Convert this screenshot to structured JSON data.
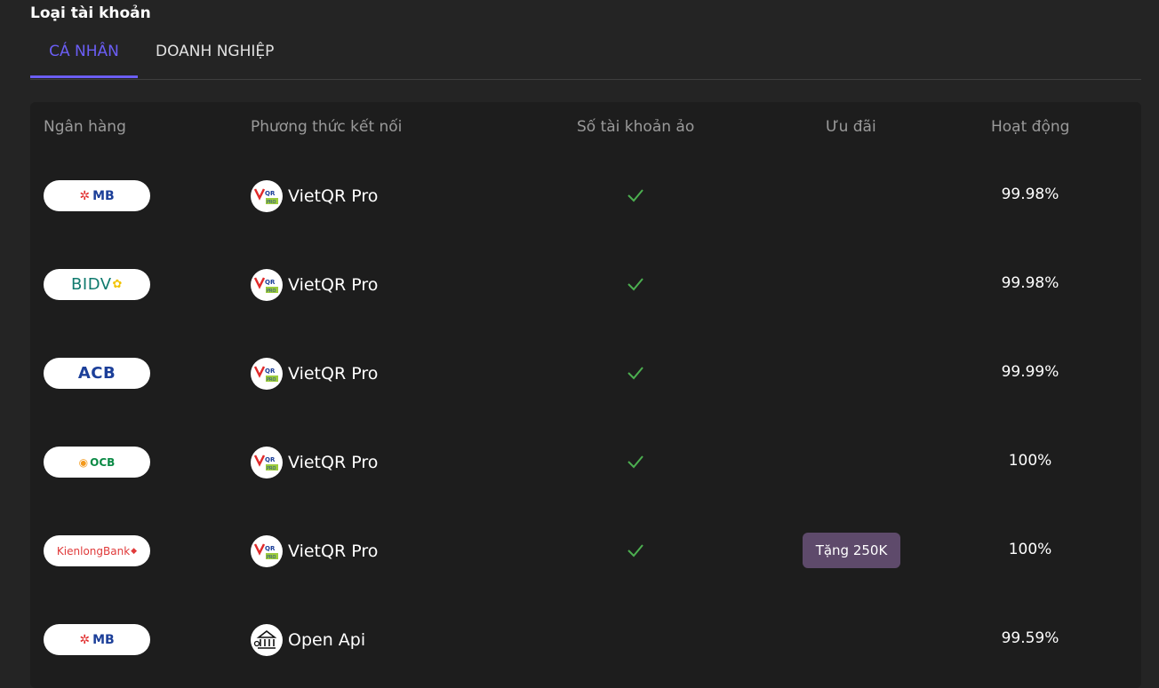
{
  "section_title": "Loại tài khoản",
  "tabs": [
    {
      "label": "CÁ NHÂN",
      "active": true
    },
    {
      "label": "DOANH NGHIỆP",
      "active": false
    }
  ],
  "table": {
    "headers": {
      "bank": "Ngân hàng",
      "method": "Phương thức kết nối",
      "virtual_account": "Số tài khoản ảo",
      "promo": "Ưu đãi",
      "uptime": "Hoạt động"
    },
    "rows": [
      {
        "bank_logo": "MB",
        "method_icon": "vietqr-pro-icon",
        "method": "VietQR Pro",
        "virtual_account": true,
        "promo": "",
        "uptime": "99.98%"
      },
      {
        "bank_logo": "BIDV",
        "method_icon": "vietqr-pro-icon",
        "method": "VietQR Pro",
        "virtual_account": true,
        "promo": "",
        "uptime": "99.98%"
      },
      {
        "bank_logo": "ACB",
        "method_icon": "vietqr-pro-icon",
        "method": "VietQR Pro",
        "virtual_account": true,
        "promo": "",
        "uptime": "99.99%"
      },
      {
        "bank_logo": "OCB",
        "method_icon": "vietqr-pro-icon",
        "method": "VietQR Pro",
        "virtual_account": true,
        "promo": "",
        "uptime": "100%"
      },
      {
        "bank_logo": "KienlongBank",
        "method_icon": "vietqr-pro-icon",
        "method": "VietQR Pro",
        "virtual_account": true,
        "promo": "Tặng 250K",
        "uptime": "100%"
      },
      {
        "bank_logo": "MB",
        "method_icon": "bank-api-icon",
        "method": "Open Api",
        "virtual_account": false,
        "promo": "",
        "uptime": "99.59%"
      }
    ]
  },
  "colors": {
    "accent": "#6b5ef5",
    "check": "#4caf50",
    "promo_bg": "#5e4a6b"
  }
}
